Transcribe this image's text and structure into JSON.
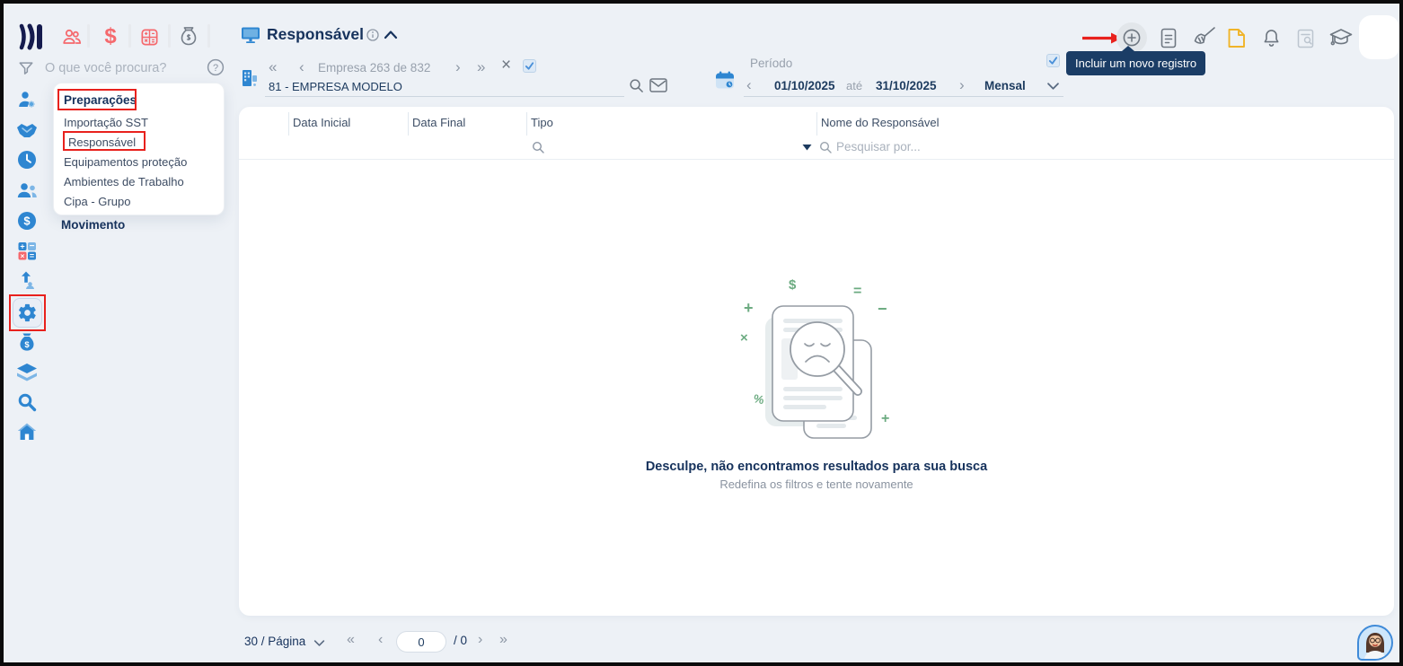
{
  "colors": {
    "accent_blue": "#2e86d1",
    "navy_text": "#16325c",
    "coral": "#f5696d",
    "annotation_red": "#e8211d",
    "tooltip_bg": "#1b3d66",
    "illustration_green": "#6cab81",
    "note_yellow": "#f0b429",
    "background": "#edf1f6"
  },
  "glyphs": {
    "first": "«",
    "prev": "‹",
    "next": "›",
    "last": "»",
    "close": "×",
    "dollar": "$",
    "help": "?"
  },
  "topbar": {
    "search": {
      "placeholder": "O que você procura?"
    },
    "module_icons": [
      "people-icon",
      "dollar-icon",
      "calculator-icon",
      "moneybag-icon"
    ]
  },
  "sidebar": {
    "icons": [
      "user-settings-icon",
      "handshake-icon",
      "clock-icon",
      "team-icon",
      "dollar-coin-icon",
      "calc-signs-icon",
      "promotion-icon",
      "gear-icon",
      "budget-bag-icon",
      "layers-icon",
      "search-icon",
      "home-icon"
    ],
    "highlighted_icon": "gear-icon"
  },
  "menu": {
    "section_title": "Preparações",
    "items": [
      {
        "label": "Importação SST"
      },
      {
        "label": "Responsável"
      },
      {
        "label": "Equipamentos proteção"
      },
      {
        "label": "Ambientes de Trabalho"
      },
      {
        "label": "Cipa - Grupo"
      }
    ],
    "next_section": "Movimento"
  },
  "header": {
    "title": "Responsável",
    "company": {
      "nav_label": "Empresa 263 de 832",
      "name": "81 - EMPRESA MODELO"
    },
    "period": {
      "label": "Período",
      "start": "01/10/2025",
      "until": "até",
      "end": "31/10/2025",
      "mode": "Mensal"
    },
    "tooltip": "Incluir um novo registro",
    "action_icons": [
      "add-record-icon",
      "document-icon",
      "broom-icon",
      "note-icon",
      "bell-icon",
      "document-search-icon",
      "graduation-cap-icon"
    ]
  },
  "table": {
    "columns": [
      {
        "label": "Data Inicial"
      },
      {
        "label": "Data Final"
      },
      {
        "label": "Tipo"
      },
      {
        "label": "Nome do Responsável"
      }
    ],
    "filter_placeholder": "Pesquisar por..."
  },
  "empty": {
    "title": "Desculpe, não encontramos resultados para sua busca",
    "subtitle": "Redefina os filtros e tente novamente"
  },
  "pagination": {
    "size_label": "30 / Página",
    "current": "0",
    "total": "/ 0"
  }
}
